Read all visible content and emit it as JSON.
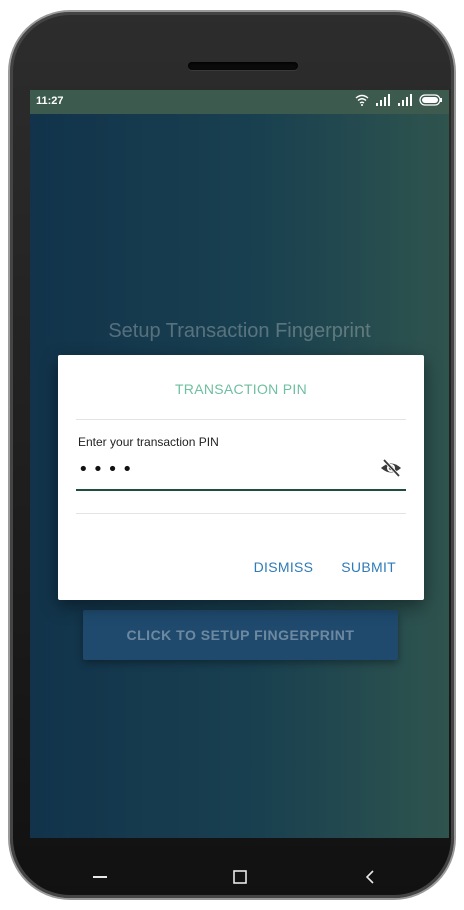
{
  "status_bar": {
    "time": "11:27",
    "icons": [
      "wifi-icon",
      "signal-icon",
      "signal-icon",
      "battery-icon"
    ]
  },
  "screen": {
    "title": "Setup Transaction Fingerprint",
    "setup_button_label": "CLICK TO SETUP FINGERPRINT"
  },
  "dialog": {
    "title": "TRANSACTION PIN",
    "field_label": "Enter your transaction PIN",
    "pin_value": "••••",
    "visibility_toggle_icon": "eye-off-icon",
    "dismiss_label": "DISMISS",
    "submit_label": "SUBMIT"
  },
  "nav_bar": {
    "items": [
      "menu-icon",
      "home-icon",
      "back-icon"
    ]
  },
  "colors": {
    "dialog_title": "#6fbfa0",
    "action_text": "#2f7bb8",
    "input_underline": "#1f4d3f",
    "status_bar": "#3d5a4e"
  }
}
